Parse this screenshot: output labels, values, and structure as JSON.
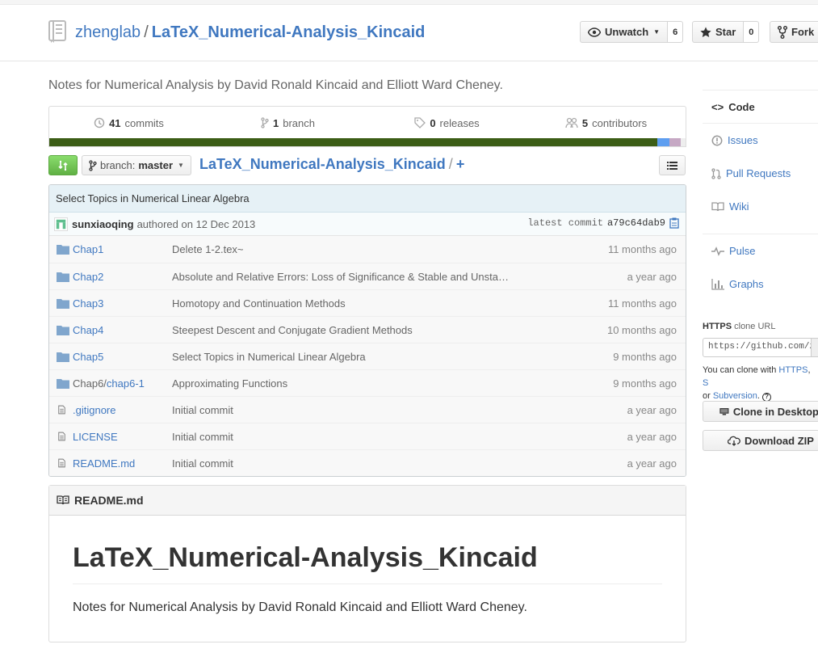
{
  "repo": {
    "owner": "zhenglab",
    "separator": "/",
    "name": "LaTeX_Numerical-Analysis_Kincaid",
    "description": "Notes for Numerical Analysis by David Ronald Kincaid and Elliott Ward Cheney."
  },
  "actions": {
    "watch_label": "Unwatch",
    "watch_count": "6",
    "star_label": "Star",
    "star_count": "0",
    "fork_label": "Fork"
  },
  "summary": {
    "commits_count": "41",
    "commits_label": "commits",
    "branch_count": "1",
    "branch_label": "branch",
    "releases_count": "0",
    "releases_label": "releases",
    "contributors_count": "5",
    "contributors_label": "contributors",
    "language_colors": [
      "#3c5d16",
      "#5e9ef0",
      "#c6a8c4",
      "#eeeeee"
    ],
    "language_shares": [
      0.955,
      0.02,
      0.018,
      0.007
    ]
  },
  "file_nav": {
    "branch_prefix": "branch:",
    "branch_name": "master",
    "breadcrumb_repo": "LaTeX_Numerical-Analysis_Kincaid",
    "breadcrumb_sep": "/",
    "breadcrumb_plus": "+"
  },
  "commit": {
    "title": "Select Topics in Numerical Linear Algebra",
    "author": "sunxiaoqing",
    "authored_text": "authored on 12 Dec 2013",
    "latest_label": "latest commit",
    "sha": "a79c64dab9"
  },
  "files": [
    {
      "type": "dir",
      "name": "Chap1",
      "message": "Delete 1-2.tex~",
      "age": "11 months ago"
    },
    {
      "type": "dir",
      "name": "Chap2",
      "message": "Absolute and Relative Errors: Loss of Significance & Stable and Unsta…",
      "age": "a year ago"
    },
    {
      "type": "dir",
      "name": "Chap3",
      "message": "Homotopy and Continuation Methods",
      "age": "11 months ago"
    },
    {
      "type": "dir",
      "name": "Chap4",
      "message": "Steepest Descent and Conjugate Gradient Methods",
      "age": "10 months ago"
    },
    {
      "type": "dir",
      "name": "Chap5",
      "message": "Select Topics in Numerical Linear Algebra",
      "age": "9 months ago"
    },
    {
      "type": "dir",
      "name": "Chap6/",
      "name_sub": "chap6-1",
      "message": "Approximating Functions",
      "age": "9 months ago"
    },
    {
      "type": "file",
      "name": ".gitignore",
      "message": "Initial commit",
      "age": "a year ago"
    },
    {
      "type": "file",
      "name": "LICENSE",
      "message": "Initial commit",
      "age": "a year ago"
    },
    {
      "type": "file",
      "name": "README.md",
      "message": "Initial commit",
      "age": "a year ago"
    }
  ],
  "readme": {
    "header": "README.md",
    "h1": "LaTeX_Numerical-Analysis_Kincaid",
    "paragraph": "Notes for Numerical Analysis by David Ronald Kincaid and Elliott Ward Cheney."
  },
  "sidebar": {
    "code": "Code",
    "issues": "Issues",
    "pull_requests": "Pull Requests",
    "wiki": "Wiki",
    "pulse": "Pulse",
    "graphs": "Graphs"
  },
  "clone": {
    "protocol": "HTTPS",
    "title_suffix": "clone URL",
    "url": "https://github.com/zhenglab/LaTeX_Numerical-Analysis_Kincaid.git",
    "help_prefix": "You can clone with",
    "help_https": "HTTPS",
    "help_comma": ",",
    "help_ssh": "S",
    "help_or": "or",
    "help_svn": "Subversion",
    "help_dot": ".",
    "clone_desktop": "Clone in Desktop",
    "download_zip": "Download ZIP"
  }
}
